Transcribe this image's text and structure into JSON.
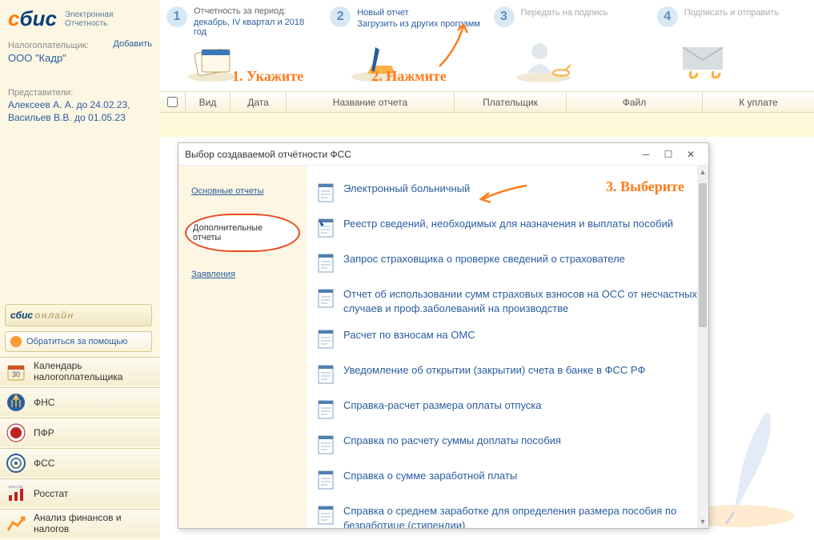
{
  "logo": {
    "brand_s": "с",
    "brand_rest": "бис",
    "subtitle1": "Электронная",
    "subtitle2": "Отчетность"
  },
  "sidebar": {
    "taxpayer_label": "Налогоплательщик:",
    "add": "Добавить",
    "company": "ООО \"Кадр\"",
    "reps_label": "Представители:",
    "reps": [
      "Алексеев А. А. до 24.02.23,",
      "Васильев В.В. до 01.05.23"
    ],
    "sbis_brand": "сбис",
    "sbis_online": "онлайн",
    "help": "Обратиться за помощью",
    "nav": [
      {
        "label": "Календарь налогоплательщика"
      },
      {
        "label": "ФНС"
      },
      {
        "label": "ПФР"
      },
      {
        "label": "ФСС"
      },
      {
        "label": "Росстат"
      },
      {
        "label": "Анализ финансов и налогов"
      }
    ]
  },
  "wizard": {
    "steps": [
      {
        "title": "Отчетность за период:",
        "link": "декабрь, IV квартал и 2018 год",
        "note": "1. Укажите"
      },
      {
        "title": "Новый отчет",
        "link": "Загрузить из других программ",
        "note": "2. Нажмите"
      },
      {
        "title": "",
        "link": "Передать на подпись",
        "note": ""
      },
      {
        "title": "",
        "link": "Подписать и отправить",
        "note": ""
      }
    ]
  },
  "table": {
    "cols": [
      "Вид",
      "Дата",
      "Название отчета",
      "Плательщик",
      "Файл",
      "К уплате"
    ]
  },
  "dialog": {
    "title": "Выбор создаваемой отчётности ФСС",
    "note": "3. Выберите",
    "nav": [
      "Основные отчеты",
      "Дополнительные отчеты",
      "Заявления"
    ],
    "items": [
      "Электронный больничный",
      "Реестр сведений, необходимых для назначения и выплаты пособий",
      "Запрос страховщика о проверке сведений о страхователе",
      "Отчет об использовании сумм страховых взносов на ОСС от несчастных случаев и проф.заболеваний на производстве",
      "Расчет по взносам на ОМС",
      "Уведомление об открытии (закрытии) счета в банке в ФСС РФ",
      "Справка-расчет размера оплаты отпуска",
      "Справка по расчету суммы доплаты пособия",
      "Справка о сумме заработной платы",
      "Справка о среднем заработке для определения размера пособия по безработице (стипендии)"
    ]
  }
}
